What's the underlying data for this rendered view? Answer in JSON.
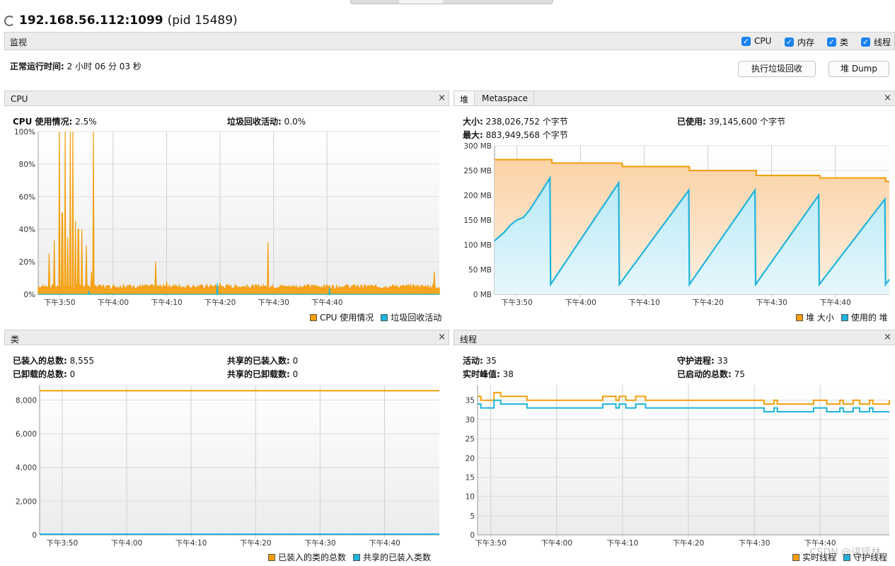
{
  "window": {
    "title": "192.168.56.112:1099",
    "pid": "(pid 15489)"
  },
  "monitor": {
    "label": "监视",
    "checkboxes": [
      {
        "label": "CPU",
        "checked": true
      },
      {
        "label": "内存",
        "checked": true
      },
      {
        "label": "类",
        "checked": true
      },
      {
        "label": "线程",
        "checked": true
      }
    ],
    "uptime_label": "正常运行时间:",
    "uptime_value": "2 小时 06 分 03 秒",
    "gc_button": "执行垃圾回收",
    "heapdump_button": "堆 Dump"
  },
  "colors": {
    "orange": "#f59e0a",
    "cyan": "#1eb4dc",
    "orange_fill": "#fbd2a6",
    "cyan_fill": "#b8e9f6"
  },
  "cpu_panel": {
    "title": "CPU",
    "close": "×",
    "usage_label": "CPU 使用情况:",
    "usage_value": "2.5%",
    "gc_label": "垃圾回收活动:",
    "gc_value": "0.0%",
    "legend": [
      "CPU 使用情况",
      "垃圾回收活动"
    ]
  },
  "heap_panel": {
    "tabs": [
      "堆",
      "Metaspace"
    ],
    "close": "×",
    "size_label": "大小:",
    "size_value": "238,026,752 个字节",
    "max_label": "最大:",
    "max_value": "883,949,568 个字节",
    "used_label": "已使用:",
    "used_value": "39,145,600 个字节",
    "legend": [
      "堆 大小",
      "使用的 堆"
    ]
  },
  "class_panel": {
    "title": "类",
    "close": "×",
    "loaded_label": "已装入的总数:",
    "loaded_value": "8,555",
    "unloaded_label": "已卸载的总数:",
    "unloaded_value": "0",
    "shared_loaded_label": "共享的已装入数:",
    "shared_loaded_value": "0",
    "shared_unloaded_label": "共享的已卸载数:",
    "shared_unloaded_value": "0",
    "legend": [
      "已装入的类的总数",
      "共享的已装入类数"
    ]
  },
  "thread_panel": {
    "title": "线程",
    "close": "×",
    "live_label": "活动:",
    "live_value": "35",
    "daemon_label": "守护进程:",
    "daemon_value": "33",
    "peak_label": "实时峰值:",
    "peak_value": "38",
    "started_label": "已启动的总数:",
    "started_value": "75",
    "legend": [
      "实时线程",
      "守护线程"
    ]
  },
  "watermark": "CSDN @讲瑶林",
  "chart_data": [
    {
      "type": "line",
      "name": "cpu",
      "x_ticks": [
        "下午3:50",
        "下午4:00",
        "下午4:10",
        "下午4:20",
        "下午4:30",
        "下午4:40"
      ],
      "y_ticks": [
        "0%",
        "20%",
        "40%",
        "60%",
        "80%",
        "100%"
      ],
      "ylim": [
        0,
        100
      ],
      "x_range_min": [
        -4,
        71
      ],
      "x_tick_min": [
        0,
        10,
        20,
        30,
        40,
        50
      ],
      "series": [
        {
          "name": "CPU 使用情况",
          "peaks": [
            [
              -2,
              25
            ],
            [
              -1,
              33
            ],
            [
              0,
              100
            ],
            [
              0.5,
              50
            ],
            [
              1,
              100
            ],
            [
              1.5,
              35
            ],
            [
              2,
              100
            ],
            [
              2.5,
              100
            ],
            [
              3,
              45
            ],
            [
              3.5,
              40
            ],
            [
              4.2,
              40
            ],
            [
              5,
              30
            ],
            [
              6,
              14
            ],
            [
              6.3,
              100
            ],
            [
              7,
              5
            ],
            [
              10,
              4
            ],
            [
              12,
              6
            ],
            [
              15,
              5
            ],
            [
              18,
              20
            ],
            [
              20,
              8
            ],
            [
              25,
              5
            ],
            [
              28,
              4
            ],
            [
              30,
              7
            ],
            [
              35,
              6
            ],
            [
              39,
              32
            ],
            [
              42,
              5
            ],
            [
              45,
              3
            ],
            [
              50,
              5
            ],
            [
              55,
              3
            ],
            [
              60,
              4
            ],
            [
              65,
              3
            ],
            [
              70,
              14
            ]
          ],
          "baseline": 3
        },
        {
          "name": "垃圾回收活动",
          "peaks": [
            [
              5.5,
              2
            ],
            [
              29.5,
              7
            ],
            [
              50.5,
              4
            ]
          ],
          "baseline": 0
        }
      ]
    },
    {
      "type": "area",
      "name": "heap",
      "x_ticks": [
        "下午3:50",
        "下午4:00",
        "下午4:10",
        "下午4:20",
        "下午4:30",
        "下午4:40"
      ],
      "y_ticks": [
        "0 MB",
        "50 MB",
        "100 MB",
        "150 MB",
        "200 MB",
        "250 MB",
        "300 MB"
      ],
      "ylim": [
        0,
        300
      ],
      "x_range_min": [
        -3.5,
        58.5
      ],
      "x_tick_min": [
        0,
        10,
        20,
        30,
        40,
        50
      ],
      "series": [
        {
          "name": "堆 大小",
          "steps": [
            [
              -3.5,
              272
            ],
            [
              5.5,
              265
            ],
            [
              16.5,
              262
            ],
            [
              16.6,
              258
            ],
            [
              27,
              258
            ],
            [
              27.1,
              250
            ],
            [
              37.5,
              250
            ],
            [
              37.6,
              240
            ],
            [
              47.5,
              240
            ],
            [
              47.6,
              235
            ],
            [
              57.8,
              235
            ],
            [
              57.9,
              228
            ],
            [
              58.5,
              228
            ]
          ]
        },
        {
          "name": "使用的 堆",
          "points": [
            [
              -3.5,
              108
            ],
            [
              -2,
              125
            ],
            [
              -1,
              140
            ],
            [
              0,
              150
            ],
            [
              1,
              155
            ],
            [
              2,
              170
            ],
            [
              4,
              210
            ],
            [
              5.2,
              235
            ],
            [
              5.3,
              20
            ],
            [
              16,
              225
            ],
            [
              16.1,
              20
            ],
            [
              27,
              210
            ],
            [
              27.1,
              20
            ],
            [
              37.4,
              210
            ],
            [
              37.5,
              20
            ],
            [
              47.4,
              200
            ],
            [
              47.5,
              20
            ],
            [
              57.8,
              192
            ],
            [
              57.9,
              20
            ],
            [
              58.5,
              30
            ]
          ]
        }
      ]
    },
    {
      "type": "line",
      "name": "classes",
      "x_ticks": [
        "下午3:50",
        "下午4:00",
        "下午4:10",
        "下午4:20",
        "下午4:30",
        "下午4:40"
      ],
      "y_ticks": [
        "0",
        "2,000",
        "4,000",
        "6,000",
        "8,000"
      ],
      "ylim": [
        0,
        8900
      ],
      "x_range_min": [
        -3.5,
        58.5
      ],
      "x_tick_min": [
        0,
        10,
        20,
        30,
        40,
        50
      ],
      "series": [
        {
          "name": "已装入的类的总数",
          "points": [
            [
              -3.5,
              8555
            ],
            [
              58.5,
              8555
            ]
          ]
        },
        {
          "name": "共享的已装入类数",
          "points": [
            [
              -3.5,
              0
            ],
            [
              58.5,
              0
            ]
          ]
        }
      ]
    },
    {
      "type": "line",
      "name": "threads",
      "x_ticks": [
        "下午3:50",
        "下午4:00",
        "下午4:10",
        "下午4:20",
        "下午4:30",
        "下午4:40"
      ],
      "y_ticks": [
        "0",
        "5",
        "10",
        "15",
        "20",
        "25",
        "30",
        "35"
      ],
      "ylim": [
        0,
        39
      ],
      "x_range_min": [
        -2,
        60.5
      ],
      "x_tick_min": [
        0,
        10,
        20,
        30,
        40,
        50
      ],
      "series": [
        {
          "name": "实时线程",
          "steps": [
            [
              -2,
              36
            ],
            [
              -1.5,
              35
            ],
            [
              0.5,
              37
            ],
            [
              1.5,
              36
            ],
            [
              5,
              36
            ],
            [
              5.5,
              35
            ],
            [
              17,
              35
            ],
            [
              17,
              36
            ],
            [
              19,
              35
            ],
            [
              19.5,
              36
            ],
            [
              20.5,
              35
            ],
            [
              22,
              36
            ],
            [
              23.5,
              35
            ],
            [
              41.5,
              35
            ],
            [
              41.5,
              34
            ],
            [
              43,
              35
            ],
            [
              43.5,
              34
            ],
            [
              49,
              34
            ],
            [
              49,
              35
            ],
            [
              51,
              34
            ],
            [
              53,
              35
            ],
            [
              53.5,
              34
            ],
            [
              55,
              35
            ],
            [
              56,
              34
            ],
            [
              57.5,
              35
            ],
            [
              58,
              34
            ],
            [
              60.5,
              35
            ]
          ]
        },
        {
          "name": "守护线程",
          "steps": [
            [
              -2,
              34
            ],
            [
              -1.5,
              33
            ],
            [
              0.5,
              35
            ],
            [
              1.5,
              34
            ],
            [
              5,
              34
            ],
            [
              5.5,
              33
            ],
            [
              17,
              33
            ],
            [
              17,
              34
            ],
            [
              19,
              33
            ],
            [
              19.5,
              34
            ],
            [
              20.5,
              33
            ],
            [
              22,
              34
            ],
            [
              23.5,
              33
            ],
            [
              41.5,
              33
            ],
            [
              41.5,
              32
            ],
            [
              43,
              33
            ],
            [
              43.5,
              32
            ],
            [
              49,
              32
            ],
            [
              49,
              33
            ],
            [
              51,
              32
            ],
            [
              53,
              33
            ],
            [
              53.5,
              32
            ],
            [
              55,
              33
            ],
            [
              56,
              32
            ],
            [
              57.5,
              33
            ],
            [
              58,
              32
            ],
            [
              60.5,
              32
            ]
          ]
        }
      ]
    }
  ]
}
